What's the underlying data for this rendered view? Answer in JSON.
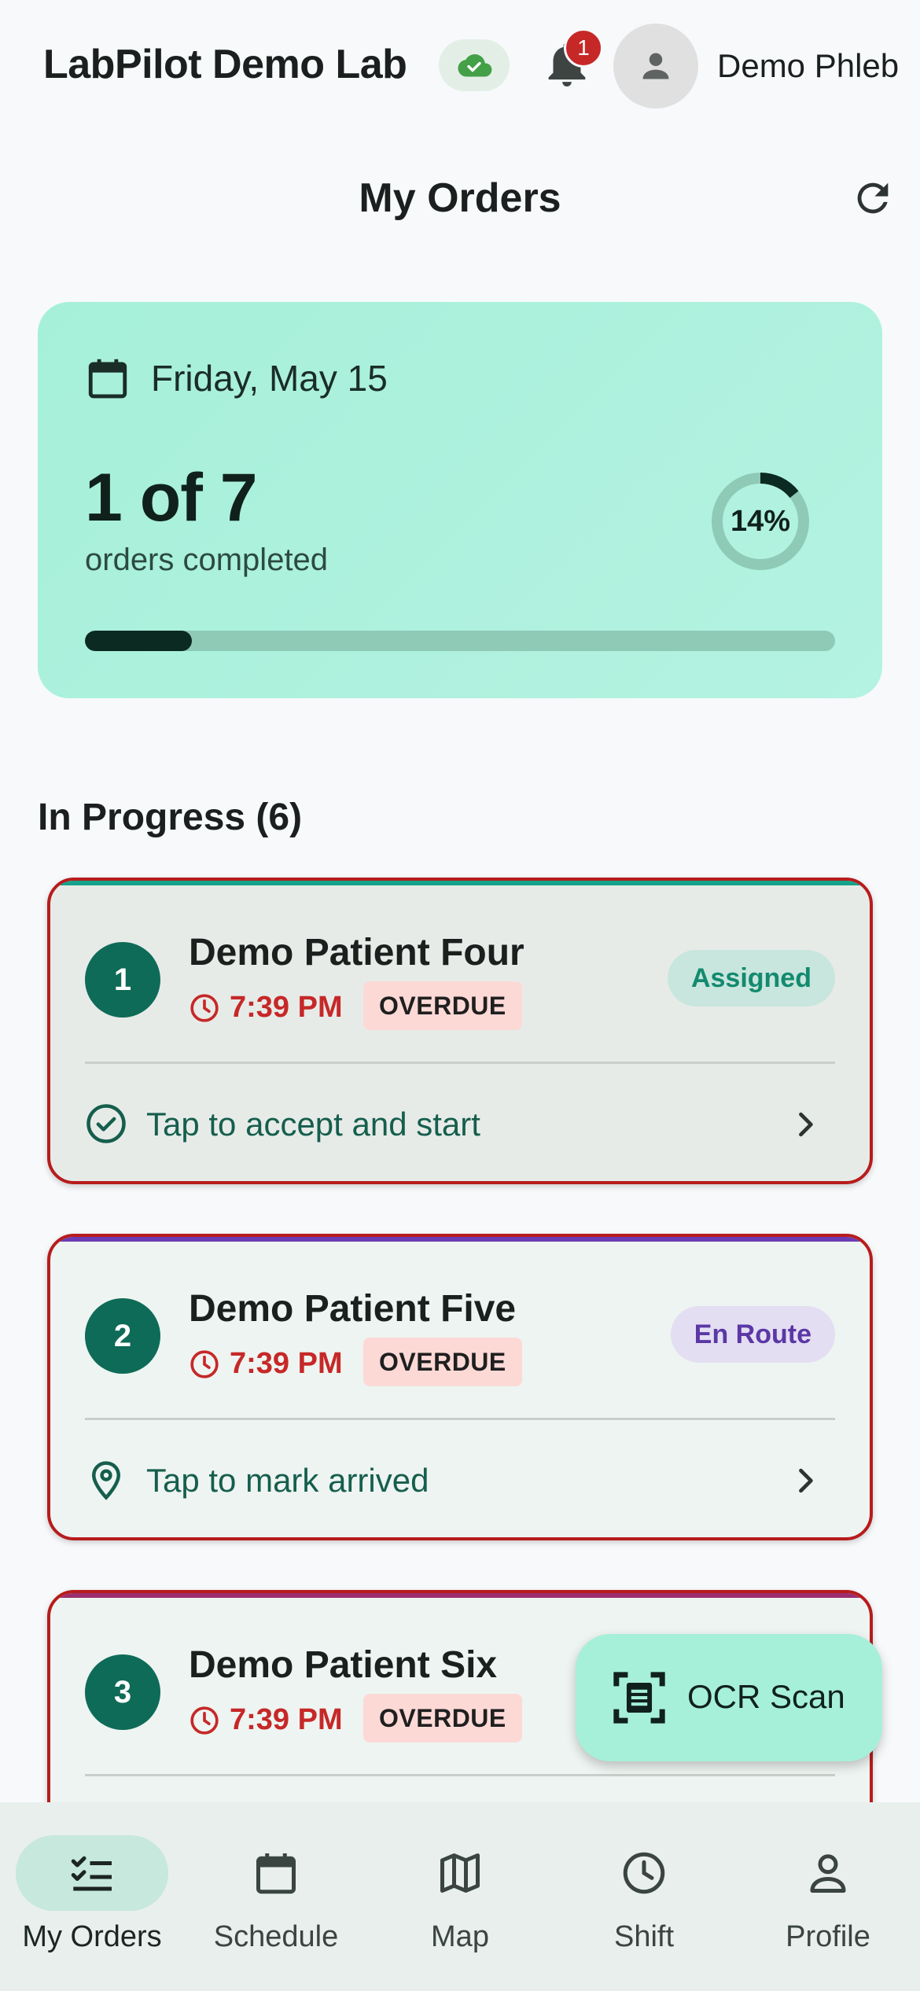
{
  "app": {
    "title": "LabPilot Demo Lab",
    "user_name": "Demo Phleb",
    "notification_count": "1",
    "sync_icon": "cloud-check-icon",
    "colors": {
      "primary": "#0e6b58",
      "accent": "#a6f0d9",
      "danger": "#c62828",
      "background": "#f7f9fb"
    }
  },
  "page": {
    "title": "My Orders",
    "refresh_icon": "refresh-icon"
  },
  "summary": {
    "date": "Friday, May 15",
    "count": "1 of 7",
    "subtitle": "orders completed",
    "percent_label": "14%",
    "completed": 1,
    "total": 7
  },
  "section": {
    "title": "In Progress (6)"
  },
  "orders": [
    {
      "number": "1",
      "patient": "Demo Patient Four",
      "time": "7:39 PM",
      "flag": "OVERDUE",
      "status": "Assigned",
      "status_bg": "#c8e6dd",
      "status_color": "#138a6f",
      "top_color": "#14a38a",
      "card_bg": "#e7ebe8",
      "action": "Tap to accept and start",
      "action_icon": "check-circle-icon"
    },
    {
      "number": "2",
      "patient": "Demo Patient Five",
      "time": "7:39 PM",
      "flag": "OVERDUE",
      "status": "En Route",
      "status_bg": "#e3def2",
      "status_color": "#5b37a6",
      "top_color": "#6a3ab2",
      "card_bg": "#eef4f1",
      "action": "Tap to mark arrived",
      "action_icon": "location-pin-icon"
    },
    {
      "number": "3",
      "patient": "Demo Patient Six",
      "time": "7:39 PM",
      "flag": "OVERDUE",
      "status": "",
      "status_bg": "transparent",
      "status_color": "#000000",
      "top_color": "#9c2d6e",
      "card_bg": "#eef4f1",
      "action": "",
      "action_icon": ""
    }
  ],
  "fab": {
    "label": "OCR Scan",
    "icon": "document-scan-icon"
  },
  "bottom_nav": [
    {
      "label": "My Orders",
      "icon": "checklist-icon",
      "active": true
    },
    {
      "label": "Schedule",
      "icon": "calendar-icon",
      "active": false
    },
    {
      "label": "Map",
      "icon": "map-icon",
      "active": false
    },
    {
      "label": "Shift",
      "icon": "clock-icon",
      "active": false
    },
    {
      "label": "Profile",
      "icon": "person-icon",
      "active": false
    }
  ]
}
